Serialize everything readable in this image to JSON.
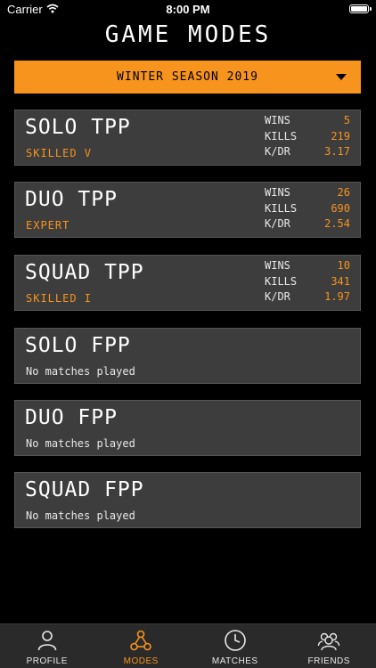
{
  "status_bar": {
    "carrier": "Carrier",
    "time": "8:00 PM"
  },
  "header": {
    "title": "GAME MODES"
  },
  "season": {
    "selected": "WINTER SEASON 2019"
  },
  "modes": [
    {
      "name": "SOLO TPP",
      "rank": "SKILLED V",
      "stats": [
        {
          "label": "WINS",
          "value": "5"
        },
        {
          "label": "KILLS",
          "value": "219"
        },
        {
          "label": "K/DR",
          "value": "3.17"
        }
      ]
    },
    {
      "name": "DUO TPP",
      "rank": "EXPERT",
      "stats": [
        {
          "label": "WINS",
          "value": "26"
        },
        {
          "label": "KILLS",
          "value": "690"
        },
        {
          "label": "K/DR",
          "value": "2.54"
        }
      ]
    },
    {
      "name": "SQUAD TPP",
      "rank": "SKILLED I",
      "stats": [
        {
          "label": "WINS",
          "value": "10"
        },
        {
          "label": "KILLS",
          "value": "341"
        },
        {
          "label": "K/DR",
          "value": "1.97"
        }
      ]
    },
    {
      "name": "SOLO FPP",
      "note": "No matches played"
    },
    {
      "name": "DUO FPP",
      "note": "No matches played"
    },
    {
      "name": "SQUAD FPP",
      "note": "No matches played"
    }
  ],
  "tabs": [
    {
      "label": "PROFILE",
      "icon": "profile-icon",
      "active": false
    },
    {
      "label": "MODES",
      "icon": "modes-icon",
      "active": true
    },
    {
      "label": "MATCHES",
      "icon": "clock-icon",
      "active": false
    },
    {
      "label": "FRIENDS",
      "icon": "friends-icon",
      "active": false
    }
  ],
  "colors": {
    "accent": "#f7941d",
    "card": "#3d3d3d",
    "background": "#000000",
    "tab_bar": "#2a2a2a"
  }
}
